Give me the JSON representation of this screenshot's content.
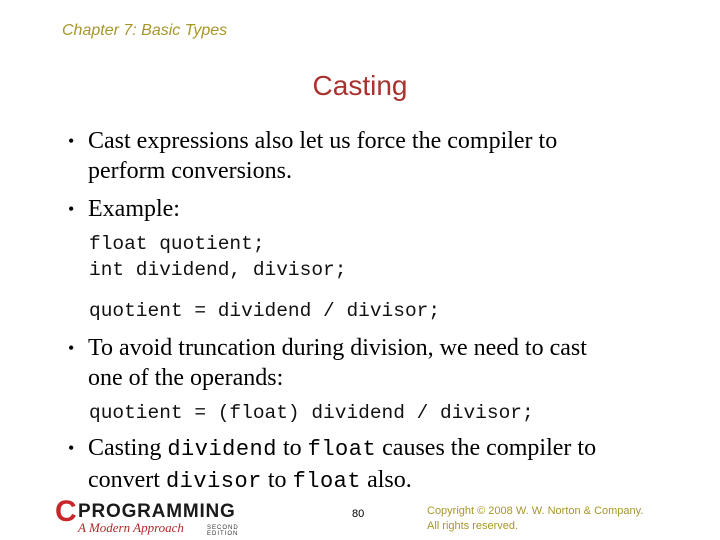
{
  "header": {
    "chapter": "Chapter 7: Basic Types",
    "title": "Casting"
  },
  "bullets": [
    {
      "line1": "Cast expressions also let us force the compiler to",
      "line2": "perform conversions."
    },
    {
      "line1": "Example:"
    },
    {
      "line1": "To avoid truncation during division, we need to cast",
      "line2": "one of the operands:"
    },
    {
      "line1_parts": [
        "Casting ",
        "dividend",
        " to ",
        "float",
        " causes the compiler to"
      ],
      "line2_parts": [
        "convert ",
        "divisor",
        " to ",
        "float",
        " also."
      ]
    }
  ],
  "code": {
    "example_decl_1": "float quotient;",
    "example_decl_2": "int dividend, divisor;",
    "example_stmt": "quotient = dividend / divisor;",
    "cast_stmt": "quotient = (float) dividend / divisor;"
  },
  "footer": {
    "logo_letter": "C",
    "logo_word": "PROGRAMMING",
    "logo_subtitle": "A Modern Approach",
    "logo_edition": "SECOND EDITION",
    "page_number": "80",
    "copyright_line1": "Copyright © 2008 W. W. Norton & Company.",
    "copyright_line2": "All rights reserved."
  },
  "colors": {
    "title": "#a8322d",
    "chapter": "#a8962a",
    "logo_red": "#c8262b"
  }
}
